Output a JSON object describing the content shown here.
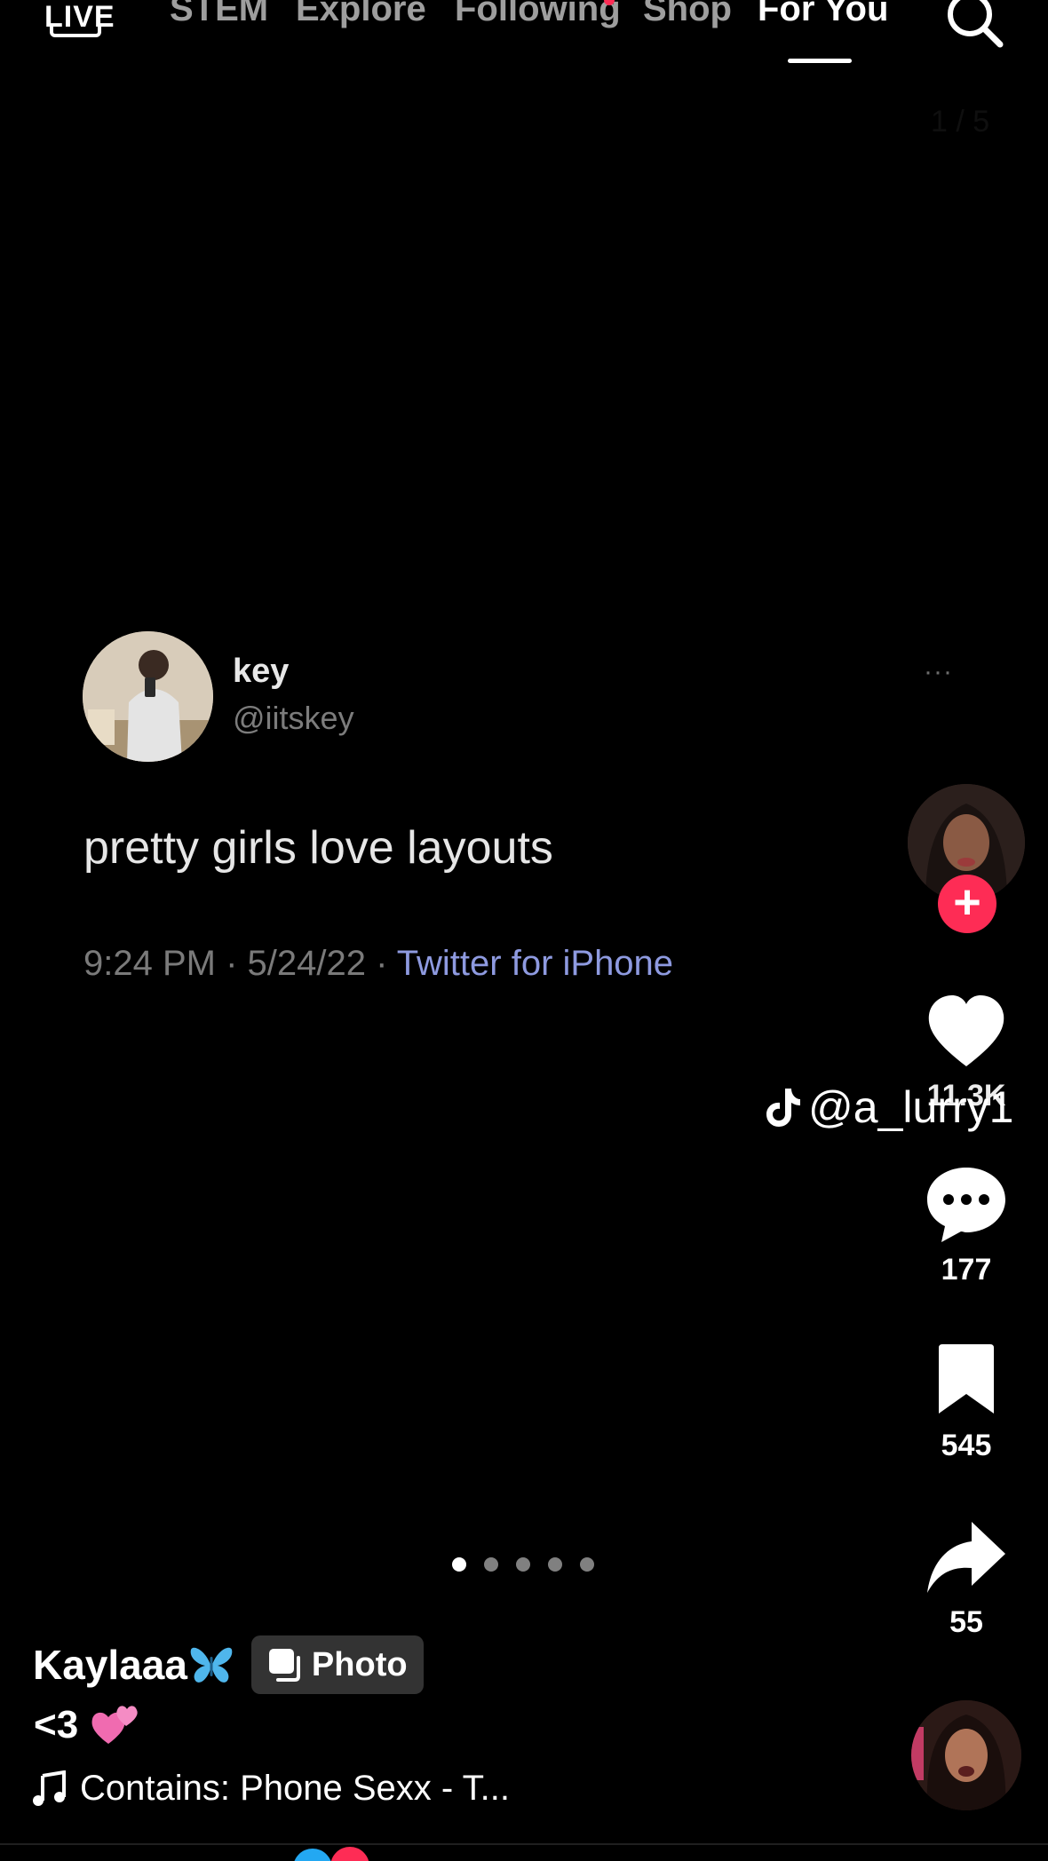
{
  "nav": {
    "live_label": "LIVE",
    "tabs": [
      {
        "label": "STEM"
      },
      {
        "label": "Explore"
      },
      {
        "label": "Following"
      },
      {
        "label": "Shop"
      },
      {
        "label": "For You"
      }
    ],
    "active_tab": "For You",
    "search_icon": "search-icon"
  },
  "post": {
    "page_counter": "1 / 5",
    "page_count": 5,
    "current_page": 1
  },
  "tweet": {
    "name": "key",
    "handle": "@iitskey",
    "more": "···",
    "text": "pretty girls love layouts",
    "time": "9:24 PM · 5/24/22 · ",
    "source": "Twitter for iPhone"
  },
  "actions": {
    "likes": "11.3K",
    "comments": "177",
    "saves": "545",
    "shares": "55",
    "follow_symbol": "+"
  },
  "watermark": {
    "handle": "@a_lurry1"
  },
  "caption": {
    "author": "Kaylaaa",
    "badge": "Photo",
    "text": "<3",
    "music": "Contains: Phone Sexx - T..."
  },
  "colors": {
    "accent_red": "#fe2c55",
    "twitter_source": "#8e9ae0",
    "butterfly": "#4fb6ec",
    "hearts": "#f06bb0"
  }
}
